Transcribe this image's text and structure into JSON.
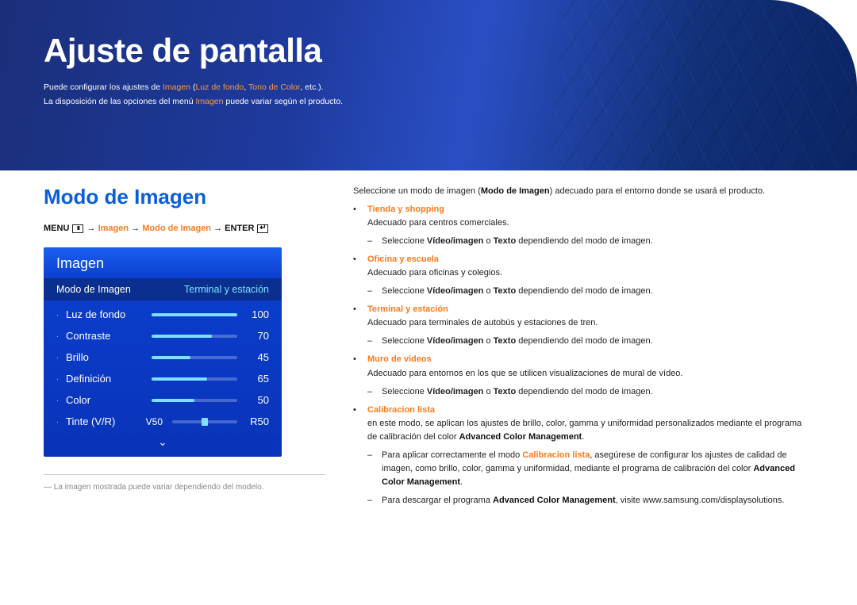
{
  "hero": {
    "title": "Ajuste de pantalla",
    "line1_pre": "Puede configurar los ajustes de ",
    "line1_accent": "Imagen",
    "line1_mid": " (",
    "line1_a2": "Luz de fondo",
    "line1_sep": ", ",
    "line1_a3": "Tono de Color",
    "line1_post": ", etc.).",
    "line2_pre": "La disposición de las opciones del menú ",
    "line2_accent": "Imagen",
    "line2_post": " puede variar según el producto."
  },
  "section_title": "Modo de Imagen",
  "menu_path": {
    "menu": "MENU",
    "arrow": "→",
    "p1": "Imagen",
    "p2": "Modo de Imagen",
    "enter": "ENTER",
    "menu_glyph": "III"
  },
  "osd": {
    "title": "Imagen",
    "sel_label": "Modo de Imagen",
    "sel_value": "Terminal y estación",
    "rows": [
      {
        "label": "Luz de fondo",
        "value": "100",
        "pct": 100
      },
      {
        "label": "Contraste",
        "value": "70",
        "pct": 70
      },
      {
        "label": "Brillo",
        "value": "45",
        "pct": 45
      },
      {
        "label": "Definición",
        "value": "65",
        "pct": 65
      },
      {
        "label": "Color",
        "value": "50",
        "pct": 50
      }
    ],
    "tint": {
      "label": "Tinte (V/R)",
      "left": "V50",
      "right": "R50"
    }
  },
  "footnote": "―  La imagen mostrada puede variar dependiendo del modelo.",
  "right": {
    "intro_pre": "Seleccione un modo de imagen (",
    "intro_bold": "Modo de Imagen",
    "intro_post": ") adecuado para el entorno donde se usará el producto.",
    "modes": [
      {
        "name": "Tienda y shopping",
        "desc": "Adecuado para centros comerciales.",
        "subs": [
          {
            "pre": "Seleccione ",
            "b1": "Vídeo/imagen",
            "mid": " o ",
            "b2": "Texto",
            "post": " dependiendo del modo de imagen."
          }
        ]
      },
      {
        "name": "Oficina y escuela",
        "desc": "Adecuado para oficinas y colegios.",
        "subs": [
          {
            "pre": "Seleccione ",
            "b1": "Vídeo/imagen",
            "mid": " o ",
            "b2": "Texto",
            "post": " dependiendo del modo de imagen."
          }
        ]
      },
      {
        "name": "Terminal y estación",
        "desc": "Adecuado para terminales de autobús y estaciones de tren.",
        "subs": [
          {
            "pre": "Seleccione ",
            "b1": "Vídeo/imagen",
            "mid": " o ",
            "b2": "Texto",
            "post": " dependiendo del modo de imagen."
          }
        ]
      },
      {
        "name": "Muro de videos",
        "desc": "Adecuado para entornos en los que se utilicen visualizaciones de mural de vídeo.",
        "subs": [
          {
            "pre": "Seleccione ",
            "b1": "Vídeo/imagen",
            "mid": " o ",
            "b2": "Texto",
            "post": " dependiendo del modo de imagen."
          }
        ]
      }
    ],
    "calib": {
      "name": "Calibracion lista",
      "desc_pre": "en este modo, se aplican los ajustes de brillo, color, gamma y uniformidad personalizados mediante el programa de calibración del color ",
      "desc_bold": "Advanced Color Management",
      "desc_post": ".",
      "sub1_pre": "Para aplicar correctamente el modo ",
      "sub1_b1": "Calibracion lista",
      "sub1_mid": ", asegúrese de configurar los ajustes de calidad de imagen, como brillo, color, gamma y uniformidad, mediante el programa de calibración del color ",
      "sub1_b2": "Advanced Color Management",
      "sub1_post": ".",
      "sub2_pre": "Para descargar el programa ",
      "sub2_b": "Advanced Color Management",
      "sub2_post": ", visite www.samsung.com/displaysolutions."
    }
  }
}
